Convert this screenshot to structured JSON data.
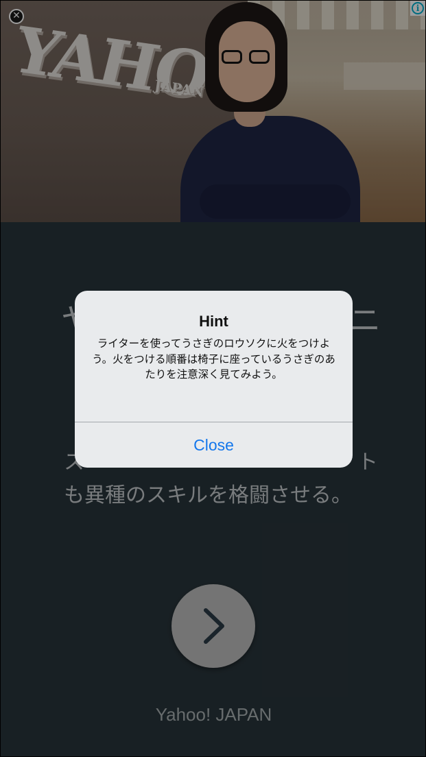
{
  "ad": {
    "photo_logo_text": "YAHOO!",
    "photo_logo_sub": "JAPAN",
    "close_icon": "close-icon",
    "info_icon": "info-icon",
    "headline_left": "ヤ",
    "headline_right": "ニ",
    "body_line1": "ス",
    "body_line1_right": "ト",
    "body_line2": "も異種のスキルを格闘させる。",
    "next_icon": "chevron-right-icon",
    "advertiser": "Yahoo! JAPAN"
  },
  "alert": {
    "title": "Hint",
    "message": "ライターを使ってうさぎのロウソクに火をつけよう。火をつける順番は椅子に座っているうさぎのあたりを注意深く見てみよう。",
    "button_label": "Close"
  },
  "colors": {
    "background": "#28343a",
    "alert_bg": "#e9ebed",
    "link_blue": "#1477ec",
    "info_cyan": "#00aecd"
  }
}
